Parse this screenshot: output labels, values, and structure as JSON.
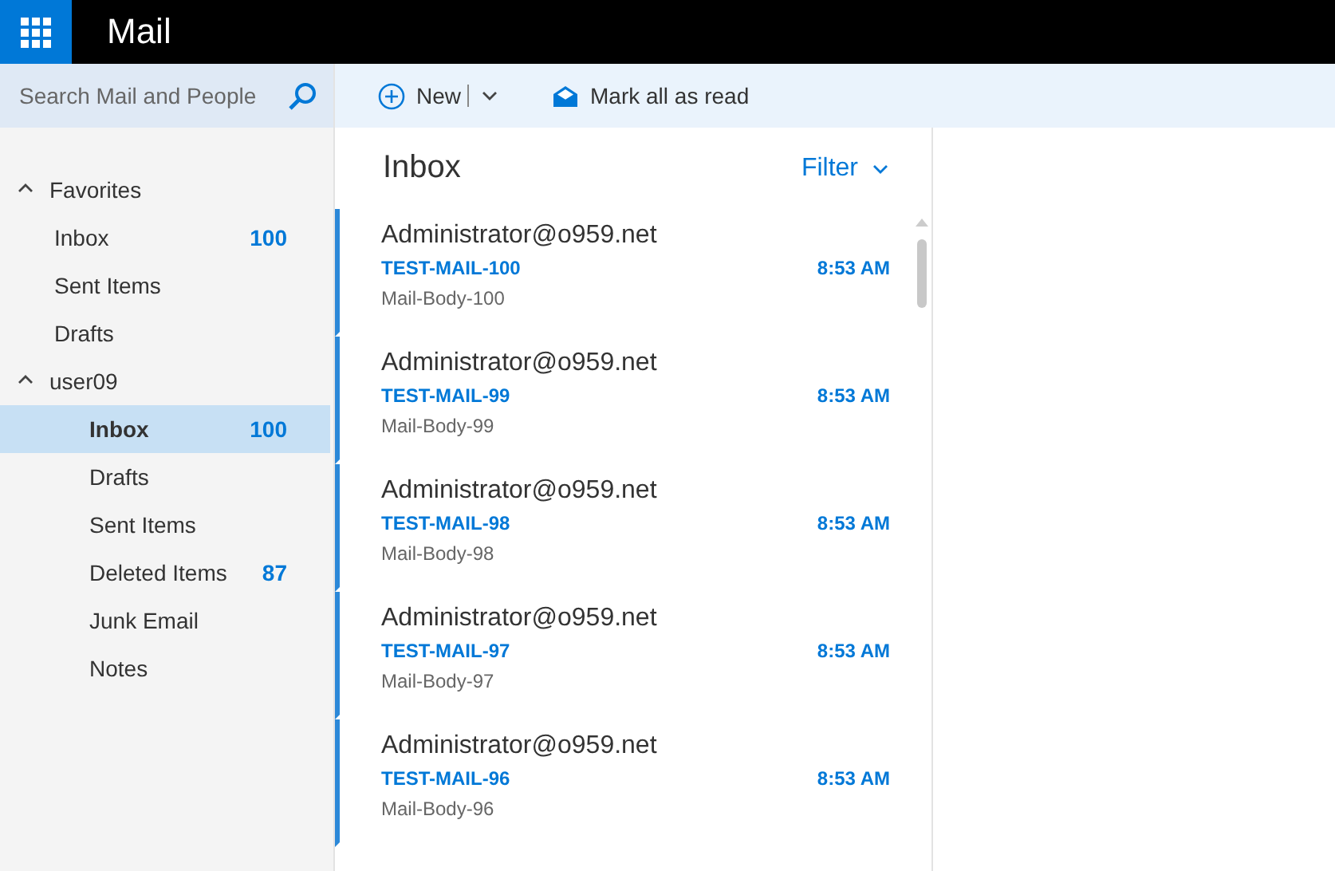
{
  "app_bar": {
    "title": "Mail"
  },
  "search": {
    "placeholder": "Search Mail and People"
  },
  "toolbar": {
    "new_label": "New",
    "mark_all_label": "Mark all as read"
  },
  "folder_groups": [
    {
      "name": "Favorites",
      "expanded": true,
      "folders": [
        {
          "name": "Inbox",
          "count": "100",
          "selected": false
        },
        {
          "name": "Sent Items",
          "selected": false
        },
        {
          "name": "Drafts",
          "selected": false
        }
      ]
    },
    {
      "name": "user09",
      "expanded": true,
      "folders": [
        {
          "name": "Inbox",
          "count": "100",
          "selected": true
        },
        {
          "name": "Drafts",
          "selected": false
        },
        {
          "name": "Sent Items",
          "selected": false
        },
        {
          "name": "Deleted Items",
          "count": "87",
          "selected": false
        },
        {
          "name": "Junk Email",
          "selected": false
        },
        {
          "name": "Notes",
          "selected": false
        }
      ]
    }
  ],
  "message_list": {
    "title": "Inbox",
    "filter_label": "Filter",
    "messages": [
      {
        "sender": "Administrator@o959.net",
        "subject": "TEST-MAIL-100",
        "time": "8:53 AM",
        "preview": "Mail-Body-100",
        "unread": true
      },
      {
        "sender": "Administrator@o959.net",
        "subject": "TEST-MAIL-99",
        "time": "8:53 AM",
        "preview": "Mail-Body-99",
        "unread": true
      },
      {
        "sender": "Administrator@o959.net",
        "subject": "TEST-MAIL-98",
        "time": "8:53 AM",
        "preview": "Mail-Body-98",
        "unread": true
      },
      {
        "sender": "Administrator@o959.net",
        "subject": "TEST-MAIL-97",
        "time": "8:53 AM",
        "preview": "Mail-Body-97",
        "unread": true
      },
      {
        "sender": "Administrator@o959.net",
        "subject": "TEST-MAIL-96",
        "time": "8:53 AM",
        "preview": "Mail-Body-96",
        "unread": true
      }
    ]
  }
}
